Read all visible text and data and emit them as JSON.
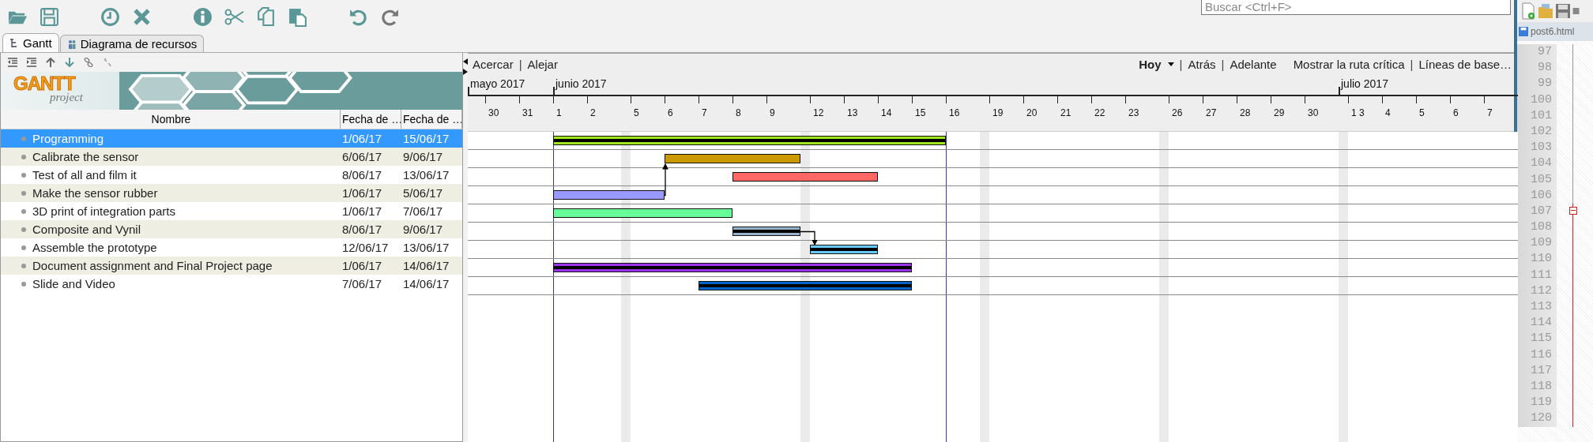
{
  "toolbar": {
    "search": {
      "placeholder": "Buscar <Ctrl+F>"
    }
  },
  "tabs": [
    {
      "label": "Gantt",
      "selected": true
    },
    {
      "label": "Diagrama de recursos",
      "selected": false
    }
  ],
  "logo": {
    "title": "GANTT",
    "subtitle": "project"
  },
  "table": {
    "columns": [
      "Nombre",
      "Fecha de …",
      "Fecha de …"
    ]
  },
  "tasks": [
    {
      "name": "Programming",
      "start": "1/06/17",
      "end": "15/06/17",
      "selected": true,
      "color": "#a0e61e",
      "completed": true,
      "linked": false
    },
    {
      "name": "Calibrate the sensor",
      "start": "6/06/17",
      "end": "9/06/17",
      "selected": false,
      "color": "#cc9900",
      "completed": false,
      "linked": false
    },
    {
      "name": "Test of all and film it",
      "start": "8/06/17",
      "end": "13/06/17",
      "selected": false,
      "color": "#ff6666",
      "completed": false,
      "linked": false
    },
    {
      "name": "Make the sensor rubber",
      "start": "1/06/17",
      "end": "5/06/17",
      "selected": false,
      "color": "#9999ff",
      "completed": false,
      "linked": true
    },
    {
      "name": "3D print of integration parts",
      "start": "1/06/17",
      "end": "7/06/17",
      "selected": false,
      "color": "#66ff99",
      "completed": false,
      "linked": false
    },
    {
      "name": "Composite and Vynil",
      "start": "8/06/17",
      "end": "9/06/17",
      "selected": false,
      "color": "#99b2cc",
      "completed": true,
      "linked": true
    },
    {
      "name": "Assemble the prototype",
      "start": "12/06/17",
      "end": "13/06/17",
      "selected": false,
      "color": "#66ccff",
      "completed": true,
      "linked": false
    },
    {
      "name": "Document assignment and Final Project page",
      "start": "1/06/17",
      "end": "14/06/17",
      "selected": false,
      "color": "#9933ee",
      "completed": true,
      "linked": false
    },
    {
      "name": "Slide and Video",
      "start": "7/06/17",
      "end": "14/06/17",
      "selected": false,
      "color": "#0066cc",
      "completed": true,
      "linked": false
    }
  ],
  "gantt_toolbar": {
    "left": [
      {
        "kind": "link",
        "text": "Acercar"
      },
      {
        "kind": "separator",
        "text": "|"
      },
      {
        "kind": "link",
        "text": "Alejar"
      }
    ],
    "right": [
      {
        "kind": "menu",
        "text": "Hoy"
      },
      {
        "kind": "separator",
        "text": "|"
      },
      {
        "kind": "link",
        "text": "Atrás"
      },
      {
        "kind": "separator",
        "text": "|"
      },
      {
        "kind": "link",
        "text": "Adelante"
      },
      {
        "kind": "link",
        "text": "Mostrar la ruta crítica"
      },
      {
        "kind": "separator",
        "text": "|"
      },
      {
        "kind": "link",
        "text": "Líneas de base…"
      }
    ]
  },
  "timeline": [
    {
      "kind": "lead",
      "month": "mayo 2017"
    },
    {
      "kind": "day",
      "label": "30"
    },
    {
      "kind": "day",
      "label": "31"
    },
    {
      "kind": "day",
      "label": "1",
      "month": "junio 2017"
    },
    {
      "kind": "day",
      "label": "2"
    },
    {
      "kind": "weekend"
    },
    {
      "kind": "day",
      "label": "5"
    },
    {
      "kind": "day",
      "label": "6"
    },
    {
      "kind": "day",
      "label": "7"
    },
    {
      "kind": "day",
      "label": "8"
    },
    {
      "kind": "day",
      "label": "9"
    },
    {
      "kind": "weekend"
    },
    {
      "kind": "day",
      "label": "12"
    },
    {
      "kind": "day",
      "label": "13"
    },
    {
      "kind": "day",
      "label": "14"
    },
    {
      "kind": "day",
      "label": "15"
    },
    {
      "kind": "day",
      "label": "16"
    },
    {
      "kind": "weekend"
    },
    {
      "kind": "day",
      "label": "19"
    },
    {
      "kind": "day",
      "label": "20"
    },
    {
      "kind": "day",
      "label": "21"
    },
    {
      "kind": "day",
      "label": "22"
    },
    {
      "kind": "day",
      "label": "23"
    },
    {
      "kind": "weekend"
    },
    {
      "kind": "day",
      "label": "26"
    },
    {
      "kind": "day",
      "label": "27"
    },
    {
      "kind": "day",
      "label": "28"
    },
    {
      "kind": "day",
      "label": "29"
    },
    {
      "kind": "day",
      "label": "30"
    },
    {
      "kind": "weekend",
      "month": "julio 2017"
    },
    {
      "kind": "day",
      "label": "1 3"
    },
    {
      "kind": "day",
      "label": "4"
    },
    {
      "kind": "day",
      "label": "5"
    },
    {
      "kind": "day",
      "label": "6"
    },
    {
      "kind": "day",
      "label": "7"
    }
  ],
  "editor": {
    "tab": "post6.html",
    "lines": [
      {
        "number": "97",
        "fold": false
      },
      {
        "number": "98",
        "fold": false
      },
      {
        "number": "99",
        "fold": false
      },
      {
        "number": "100",
        "fold": false
      },
      {
        "number": "101",
        "fold": false
      },
      {
        "number": "102",
        "fold": false
      },
      {
        "number": "103",
        "fold": false
      },
      {
        "number": "104",
        "fold": false
      },
      {
        "number": "105",
        "fold": false
      },
      {
        "number": "106",
        "fold": false
      },
      {
        "number": "107",
        "fold": true
      },
      {
        "number": "108",
        "fold": false
      },
      {
        "number": "109",
        "fold": false
      },
      {
        "number": "110",
        "fold": false
      },
      {
        "number": "111",
        "fold": false
      },
      {
        "number": "112",
        "fold": false
      },
      {
        "number": "113",
        "fold": false
      },
      {
        "number": "114",
        "fold": false
      },
      {
        "number": "115",
        "fold": false
      },
      {
        "number": "116",
        "fold": false
      },
      {
        "number": "117",
        "fold": false
      },
      {
        "number": "118",
        "fold": false
      },
      {
        "number": "119",
        "fold": false
      },
      {
        "number": "120",
        "fold": false
      }
    ]
  }
}
